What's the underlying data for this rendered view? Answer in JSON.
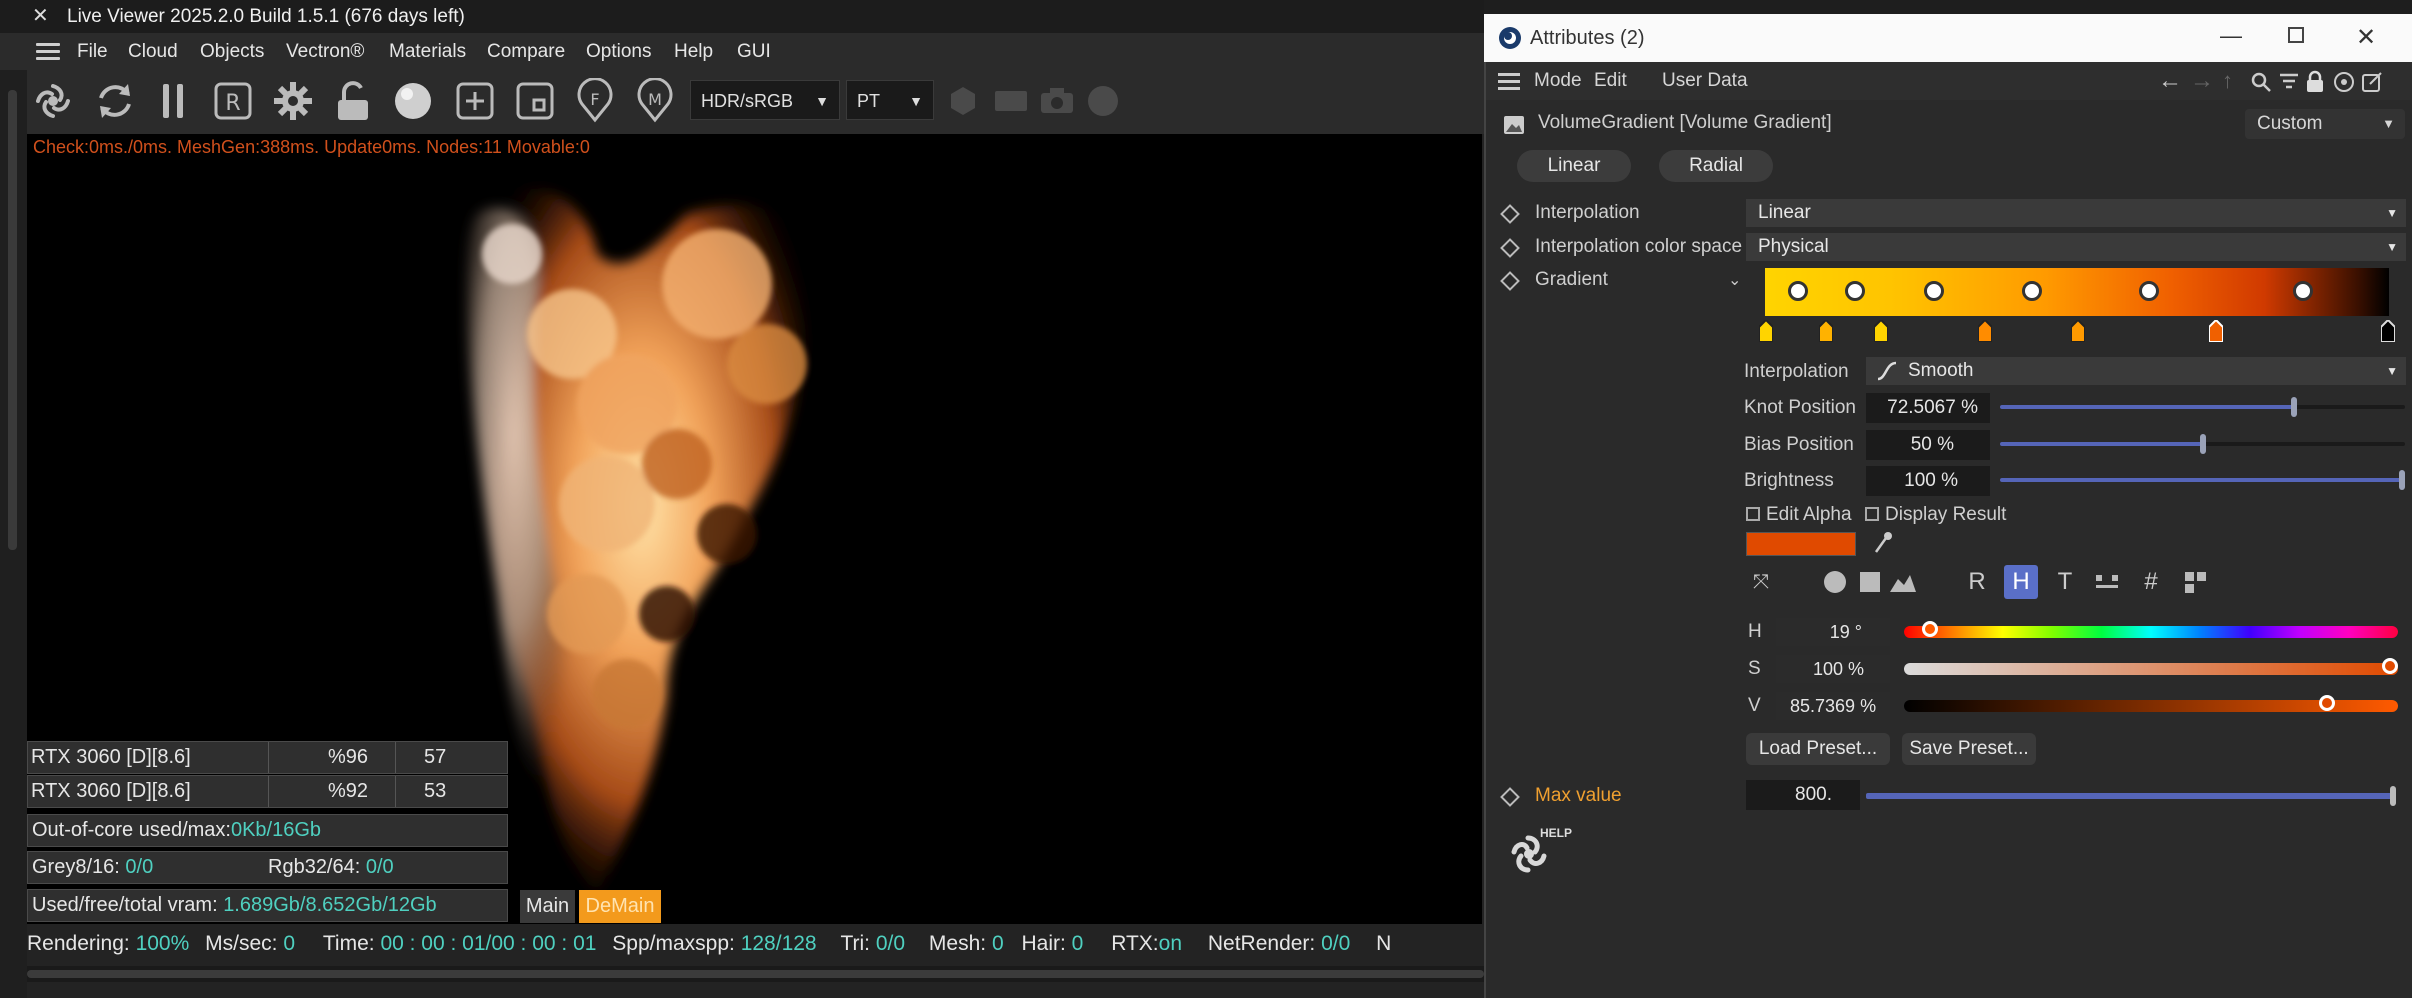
{
  "viewer": {
    "title": "Live Viewer 2025.2.0 Build 1.5.1 (676 days left)",
    "menu": [
      "File",
      "Cloud",
      "Objects",
      "Vectron®",
      "Materials",
      "Compare",
      "Options",
      "Help",
      "GUI"
    ],
    "toolbar": {
      "color_space": "HDR/sRGB",
      "kernel": "PT"
    },
    "status_overlay": "Check:0ms./0ms. MeshGen:388ms. Update0ms. Nodes:11 Movable:0",
    "gpus": [
      {
        "name": "RTX 3060 [D][8.6]",
        "usage": "%96",
        "temp": "57"
      },
      {
        "name": "RTX 3060 [D][8.6]",
        "usage": "%92",
        "temp": "53"
      }
    ],
    "ooc": {
      "label": "Out-of-core used/max:",
      "value": "0Kb/16Gb"
    },
    "grey": {
      "label": "Grey8/16:",
      "value": "0/0"
    },
    "rgb": {
      "label": "Rgb32/64:",
      "value": "0/0"
    },
    "vram": {
      "label": "Used/free/total vram:",
      "value": "1.689Gb/8.652Gb/12Gb"
    },
    "tabs": {
      "main": "Main",
      "demain": "DeMain"
    },
    "bottom": {
      "rendering_label": "Rendering:",
      "rendering_value": "100%",
      "ms_label": "Ms/sec:",
      "ms_value": "0",
      "time_label": "Time:",
      "time_value": "00 : 00 : 01/00 : 00 : 01",
      "spp_label": "Spp/maxspp:",
      "spp_value": "128/128",
      "tri_label": "Tri:",
      "tri_value": "0/0",
      "mesh_label": "Mesh:",
      "mesh_value": "0",
      "hair_label": "Hair:",
      "hair_value": "0",
      "rtx_label": "RTX:",
      "rtx_value": "on",
      "net_label": "NetRender:",
      "net_value": "0/0",
      "trail": "N"
    }
  },
  "attributes": {
    "title": "Attributes (2)",
    "menu": [
      "Mode",
      "Edit",
      "User Data"
    ],
    "object_name": "VolumeGradient [Volume Gradient]",
    "preset": "Custom",
    "tabs": [
      "Linear",
      "Radial"
    ],
    "interpolation": {
      "label": "Interpolation",
      "value": "Linear"
    },
    "interp_space": {
      "label": "Interpolation color space",
      "value": "Physical"
    },
    "gradient": {
      "label": "Gradient"
    },
    "knot_interp": {
      "label": "Interpolation",
      "value": "Smooth"
    },
    "knot_position": {
      "label": "Knot Position",
      "value": "72.5067 %",
      "fraction": 0.725
    },
    "bias_position": {
      "label": "Bias Position",
      "value": "50 %",
      "fraction": 0.5
    },
    "brightness": {
      "label": "Brightness",
      "value": "100 %",
      "fraction": 1.0
    },
    "edit_alpha": "Edit Alpha",
    "display_result": "Display Result",
    "swatch_color": "#e04a00",
    "color_modes": [
      "R",
      "H",
      "T"
    ],
    "hsv": {
      "h": {
        "label": "H",
        "value": "19 °",
        "fraction": 0.053
      },
      "s": {
        "label": "S",
        "value": "100 %",
        "fraction": 1.0
      },
      "v": {
        "label": "V",
        "value": "85.7369 %",
        "fraction": 0.857
      }
    },
    "load_preset": "Load Preset...",
    "save_preset": "Save Preset...",
    "max_value": {
      "label": "Max value",
      "value": "800."
    },
    "help_label": "HELP"
  }
}
